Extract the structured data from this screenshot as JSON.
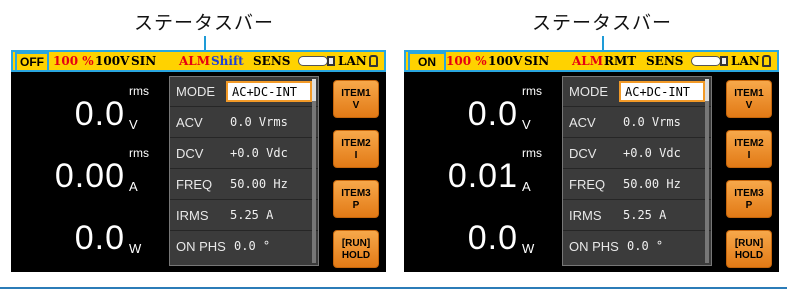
{
  "captions": {
    "left": "ステータスバー",
    "right": "ステータスバー"
  },
  "screens": [
    {
      "status": {
        "output": "OFF",
        "percent": "100 %",
        "voltage": "100V",
        "wave": "SIN",
        "alm": "ALM",
        "mode": "Shift",
        "sens": "SENS",
        "lan": "LAN"
      },
      "meas": [
        {
          "value": "0.0",
          "sup": "rms",
          "unit": "V"
        },
        {
          "value": "0.00",
          "sup": "rms",
          "unit": "A"
        },
        {
          "value": "0.0",
          "sup": "",
          "unit": "W"
        }
      ],
      "rows": [
        {
          "label": "MODE",
          "value": "AC+DC-INT"
        },
        {
          "label": "ACV",
          "value": "0.0 Vrms"
        },
        {
          "label": "DCV",
          "value": "+0.0 Vdc"
        },
        {
          "label": "FREQ",
          "value": "50.00 Hz"
        },
        {
          "label": "IRMS",
          "value": "5.25 A"
        },
        {
          "label": "ON PHS",
          "value": "0.0 °"
        }
      ],
      "softkeys": [
        {
          "line1": "ITEM1",
          "line2": "V"
        },
        {
          "line1": "ITEM2",
          "line2": "I"
        },
        {
          "line1": "ITEM3",
          "line2": "P"
        },
        {
          "line1": "[RUN]",
          "line2": "HOLD"
        }
      ]
    },
    {
      "status": {
        "output": "ON",
        "percent": "100 %",
        "voltage": "100V",
        "wave": "SIN",
        "alm": "ALM",
        "mode": "RMT",
        "sens": "SENS",
        "lan": "LAN"
      },
      "meas": [
        {
          "value": "0.0",
          "sup": "rms",
          "unit": "V"
        },
        {
          "value": "0.01",
          "sup": "rms",
          "unit": "A"
        },
        {
          "value": "0.0",
          "sup": "",
          "unit": "W"
        }
      ],
      "rows": [
        {
          "label": "MODE",
          "value": "AC+DC-INT"
        },
        {
          "label": "ACV",
          "value": "0.0 Vrms"
        },
        {
          "label": "DCV",
          "value": "+0.0 Vdc"
        },
        {
          "label": "FREQ",
          "value": "50.00 Hz"
        },
        {
          "label": "IRMS",
          "value": "5.25 A"
        },
        {
          "label": "ON PHS",
          "value": "0.0 °"
        }
      ],
      "softkeys": [
        {
          "line1": "ITEM1",
          "line2": "V"
        },
        {
          "line1": "ITEM2",
          "line2": "I"
        },
        {
          "line1": "ITEM3",
          "line2": "P"
        },
        {
          "line1": "[RUN]",
          "line2": "HOLD"
        }
      ]
    }
  ],
  "colors": {
    "status_bg": "#FFD200",
    "status_border": "#29A6DF",
    "percent": "#E60012",
    "alm": "#E60012",
    "shift": "#1F3FD6",
    "softkey": "#F29A28"
  }
}
